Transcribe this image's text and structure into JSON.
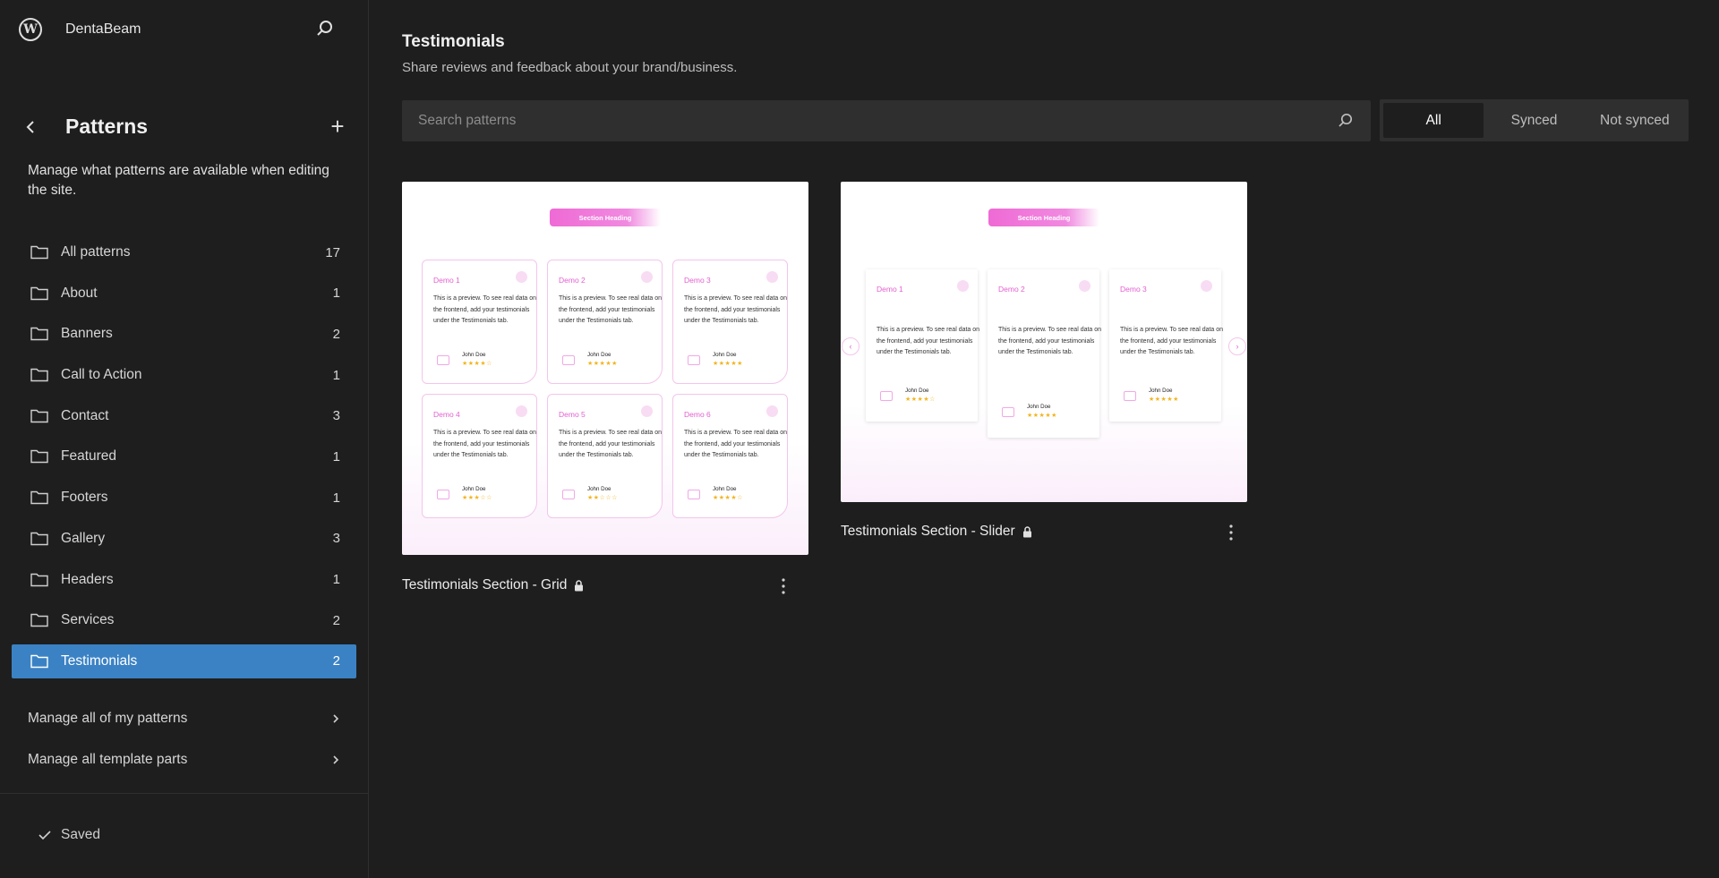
{
  "site": {
    "name": "DentaBeam"
  },
  "sidebar": {
    "title": "Patterns",
    "description": "Manage what patterns are available when editing the site.",
    "categories": [
      {
        "label": "All patterns",
        "count": "17"
      },
      {
        "label": "About",
        "count": "1"
      },
      {
        "label": "Banners",
        "count": "2"
      },
      {
        "label": "Call to Action",
        "count": "1"
      },
      {
        "label": "Contact",
        "count": "3"
      },
      {
        "label": "Featured",
        "count": "1"
      },
      {
        "label": "Footers",
        "count": "1"
      },
      {
        "label": "Gallery",
        "count": "3"
      },
      {
        "label": "Headers",
        "count": "1"
      },
      {
        "label": "Services",
        "count": "2"
      },
      {
        "label": "Testimonials",
        "count": "2"
      }
    ],
    "active_category": "Testimonials",
    "manage_patterns": "Manage all of my patterns",
    "manage_template_parts": "Manage all template parts",
    "saved_label": "Saved"
  },
  "main": {
    "title": "Testimonials",
    "description": "Share reviews and feedback about your brand/business.",
    "search_placeholder": "Search patterns",
    "filters": [
      "All",
      "Synced",
      "Not synced"
    ],
    "active_filter": "All",
    "patterns": [
      {
        "title": "Testimonials Section - Grid",
        "locked": true,
        "preview": {
          "heading": "Section Heading",
          "cards": [
            {
              "name": "Demo 1",
              "author": "John Doe",
              "stars": "★★★★☆"
            },
            {
              "name": "Demo 2",
              "author": "John Doe",
              "stars": "★★★★★"
            },
            {
              "name": "Demo 3",
              "author": "John Doe",
              "stars": "★★★★★"
            },
            {
              "name": "Demo 4",
              "author": "John Doe",
              "stars": "★★★☆☆"
            },
            {
              "name": "Demo 5",
              "author": "John Doe",
              "stars": "★★☆☆☆"
            },
            {
              "name": "Demo 6",
              "author": "John Doe",
              "stars": "★★★★☆"
            }
          ],
          "body_text": "This is a preview. To see real data on the frontend, add your testimonials under the Testimonials tab."
        }
      },
      {
        "title": "Testimonials Section - Slider",
        "locked": true,
        "preview": {
          "heading": "Section Heading",
          "cards": [
            {
              "name": "Demo 1",
              "author": "John Doe",
              "stars": "★★★★☆"
            },
            {
              "name": "Demo 2",
              "author": "John Doe",
              "stars": "★★★★★"
            },
            {
              "name": "Demo 3",
              "author": "John Doe",
              "stars": "★★★★★"
            }
          ],
          "body_text": "This is a preview. To see real data on the frontend, add your testimonials under the Testimonials tab."
        }
      }
    ]
  },
  "colors": {
    "background": "#1e1e1e",
    "accent": "#3b82c4",
    "preview_pink": "#e35fd0",
    "star": "#f2b51f"
  }
}
